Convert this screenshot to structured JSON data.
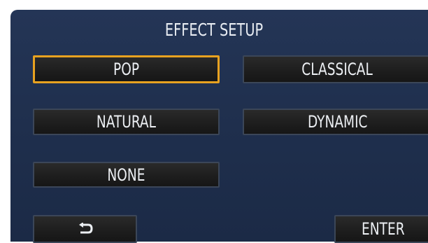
{
  "screen": {
    "title": "EFFECT SETUP"
  },
  "options": [
    {
      "id": "pop",
      "label": "POP",
      "selected": true
    },
    {
      "id": "classical",
      "label": "CLASSICAL",
      "selected": false
    },
    {
      "id": "natural",
      "label": "NATURAL",
      "selected": false
    },
    {
      "id": "dynamic",
      "label": "DYNAMIC",
      "selected": false
    },
    {
      "id": "none",
      "label": "NONE",
      "selected": false
    }
  ],
  "footer": {
    "return_icon": "return-arrow-icon",
    "enter_label": "ENTER"
  },
  "colors": {
    "background": "#1f2f4d",
    "button": "#1e1e1e",
    "selected_border": "#e8a220",
    "text": "#eceff3"
  }
}
